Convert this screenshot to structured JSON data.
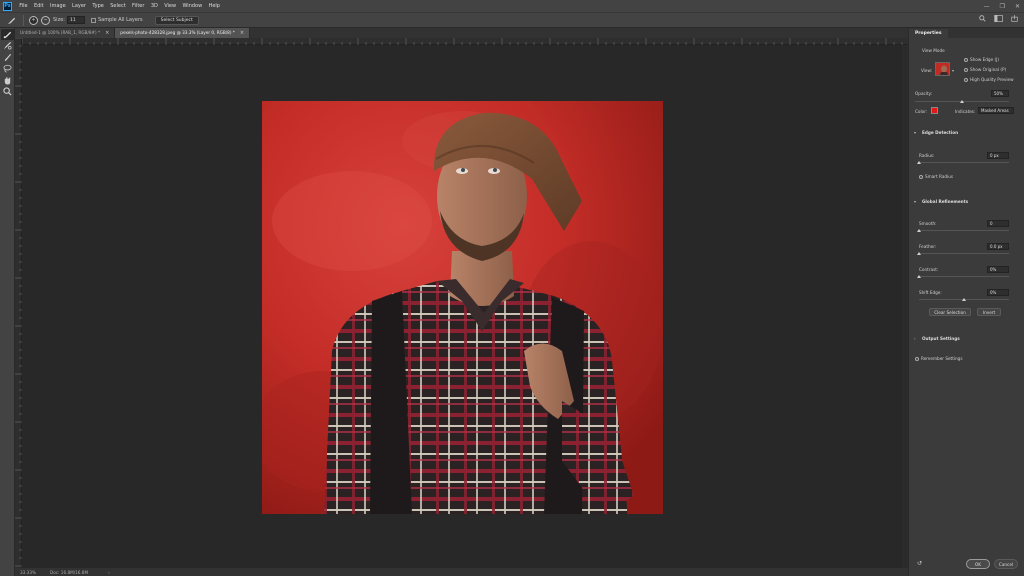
{
  "app": {
    "logo": "Ps",
    "menu": [
      "File",
      "Edit",
      "Image",
      "Layer",
      "Type",
      "Select",
      "Filter",
      "3D",
      "View",
      "Window",
      "Help"
    ],
    "window_controls": [
      "—",
      "❐",
      "✕"
    ]
  },
  "options_bar": {
    "size_label": "Size:",
    "size_value": "11",
    "sample_all_layers": "Sample All Layers",
    "select_subject": "Select Subject"
  },
  "tabs": [
    {
      "label": "Untitled-1 @ 100% (RAB_1, RGB/8#) *",
      "active": false
    },
    {
      "label": "pexels-photo-428328.jpeg @ 33.3% (Layer 0, RGB/8) *",
      "active": true
    }
  ],
  "status": {
    "zoom": "33.33%",
    "doc": "Doc: 16.8M/16.8M",
    "arrow": "›"
  },
  "properties": {
    "panel_title": "Properties",
    "view_mode_label": "View Mode",
    "view_label": "View:",
    "show_edge": "Show Edge (J)",
    "show_original": "Show Original (P)",
    "high_quality": "High Quality Preview",
    "opacity_label": "Opacity:",
    "opacity_value": "50%",
    "opacity_fraction": 0.5,
    "color_label": "Color:",
    "indicates_label": "Indicates:",
    "indicates_value": "Masked Areas",
    "edge_detection": "Edge Detection",
    "radius_label": "Radius:",
    "radius_value": "0 px",
    "radius_fraction": 0.0,
    "smart_radius": "Smart Radius",
    "global_refinements": "Global Refinements",
    "smooth_label": "Smooth:",
    "smooth_value": "0",
    "smooth_fraction": 0.0,
    "feather_label": "Feather:",
    "feather_value": "0.0 px",
    "feather_fraction": 0.0,
    "contrast_label": "Contrast:",
    "contrast_value": "0%",
    "contrast_fraction": 0.0,
    "shift_edge_label": "Shift Edge:",
    "shift_edge_value": "0%",
    "shift_edge_fraction": 0.5,
    "clear_selection": "Clear Selection",
    "invert": "Invert",
    "output_settings": "Output Settings",
    "remember_settings": "Remember Settings",
    "ok": "OK",
    "cancel": "Cancel"
  },
  "colors": {
    "overlay_red": "#e01818",
    "chrome": "#434343",
    "canvas_bg": "#282828"
  }
}
